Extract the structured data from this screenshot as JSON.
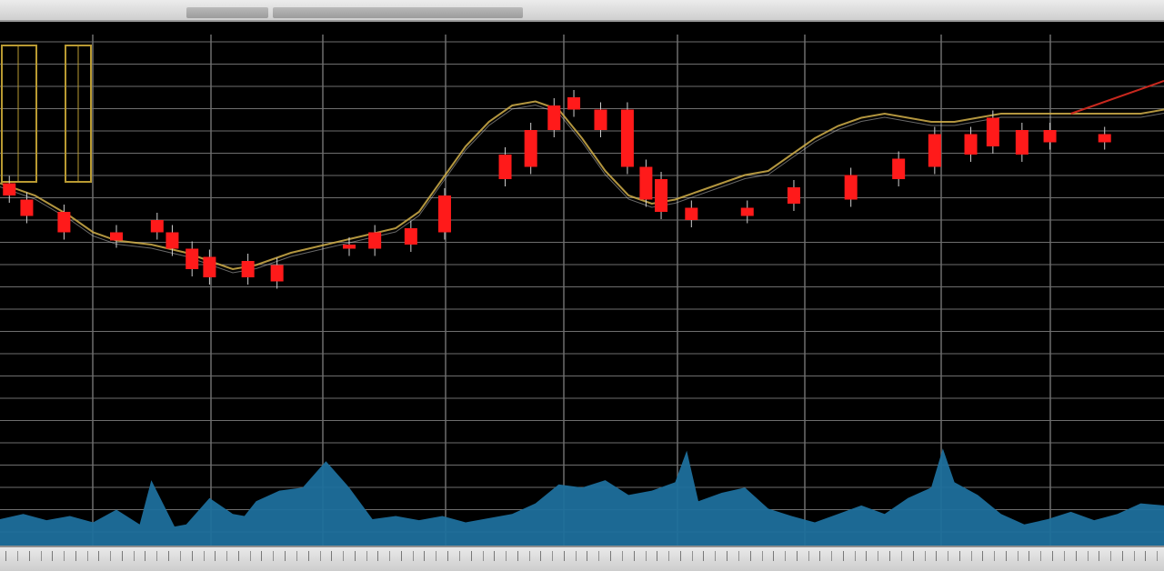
{
  "colors": {
    "background": "#000000",
    "grid": "#6e6e6e",
    "candle_down": "#ff1a1a",
    "wick": "#cfcfcf",
    "volume": "#1e6f9c",
    "price_line": "#d2b04a",
    "trend_line": "#c8281e"
  },
  "chart_data": {
    "type": "candlestick",
    "title": "",
    "xlabel": "",
    "ylabel": "",
    "grid": true,
    "xlim": [
      0,
      100
    ],
    "ylim": [
      0,
      100
    ],
    "volume_ylim": [
      0,
      100
    ],
    "price_line": {
      "x": [
        0,
        3,
        6,
        8,
        10,
        13,
        16,
        18,
        20,
        22,
        25,
        28,
        31,
        34,
        36,
        38,
        40,
        42,
        44,
        46,
        48,
        50,
        52,
        54,
        56,
        58,
        60,
        62,
        64,
        66,
        68,
        70,
        72,
        74,
        76,
        78,
        80,
        82,
        84,
        86,
        88,
        90,
        92,
        94,
        96,
        98,
        100
      ],
      "y": [
        65,
        62,
        57,
        53,
        51,
        50,
        48,
        46,
        44,
        45,
        48,
        50,
        52,
        54,
        58,
        66,
        74,
        80,
        84,
        85,
        83,
        76,
        68,
        62,
        60,
        61,
        63,
        65,
        67,
        68,
        72,
        76,
        79,
        81,
        82,
        81,
        80,
        80,
        81,
        82,
        82,
        82,
        82,
        82,
        82,
        82,
        83
      ]
    },
    "candles": [
      {
        "x": 0.8,
        "open": 65,
        "close": 62
      },
      {
        "x": 2.3,
        "open": 61,
        "close": 57
      },
      {
        "x": 5.5,
        "open": 58,
        "close": 53
      },
      {
        "x": 10.0,
        "open": 53,
        "close": 51
      },
      {
        "x": 13.5,
        "open": 56,
        "close": 53
      },
      {
        "x": 14.8,
        "open": 53,
        "close": 49
      },
      {
        "x": 16.5,
        "open": 49,
        "close": 44
      },
      {
        "x": 18.0,
        "open": 47,
        "close": 42
      },
      {
        "x": 21.3,
        "open": 46,
        "close": 42
      },
      {
        "x": 23.8,
        "open": 45,
        "close": 41
      },
      {
        "x": 30.0,
        "open": 50,
        "close": 49
      },
      {
        "x": 32.2,
        "open": 53,
        "close": 49
      },
      {
        "x": 35.3,
        "open": 54,
        "close": 50
      },
      {
        "x": 38.2,
        "open": 62,
        "close": 53
      },
      {
        "x": 43.4,
        "open": 72,
        "close": 66
      },
      {
        "x": 45.6,
        "open": 78,
        "close": 69
      },
      {
        "x": 47.6,
        "open": 84,
        "close": 78
      },
      {
        "x": 49.3,
        "open": 86,
        "close": 83
      },
      {
        "x": 51.6,
        "open": 83,
        "close": 78
      },
      {
        "x": 53.9,
        "open": 83,
        "close": 69
      },
      {
        "x": 55.5,
        "open": 69,
        "close": 61
      },
      {
        "x": 56.8,
        "open": 66,
        "close": 58
      },
      {
        "x": 59.4,
        "open": 59,
        "close": 56
      },
      {
        "x": 64.2,
        "open": 59,
        "close": 57
      },
      {
        "x": 68.2,
        "open": 64,
        "close": 60
      },
      {
        "x": 73.1,
        "open": 67,
        "close": 61
      },
      {
        "x": 77.2,
        "open": 71,
        "close": 66
      },
      {
        "x": 80.3,
        "open": 77,
        "close": 69
      },
      {
        "x": 83.4,
        "open": 77,
        "close": 72
      },
      {
        "x": 85.3,
        "open": 81,
        "close": 74
      },
      {
        "x": 87.8,
        "open": 78,
        "close": 72
      },
      {
        "x": 90.2,
        "open": 78,
        "close": 75
      },
      {
        "x": 94.9,
        "open": 77,
        "close": 75
      }
    ],
    "volume": {
      "x": [
        0,
        2,
        4,
        6,
        8,
        10,
        12,
        13,
        14,
        15,
        16,
        18,
        20,
        21,
        22,
        24,
        26,
        28,
        30,
        32,
        34,
        36,
        38,
        40,
        42,
        44,
        46,
        48,
        50,
        52,
        54,
        56,
        58,
        59,
        60,
        62,
        64,
        66,
        68,
        70,
        72,
        74,
        76,
        78,
        80,
        81,
        82,
        84,
        86,
        88,
        90,
        92,
        94,
        96,
        98,
        100
      ],
      "y": [
        25,
        30,
        24,
        28,
        22,
        34,
        20,
        62,
        40,
        18,
        20,
        45,
        30,
        28,
        42,
        52,
        55,
        80,
        55,
        25,
        28,
        24,
        28,
        22,
        26,
        30,
        40,
        58,
        55,
        62,
        48,
        52,
        60,
        90,
        42,
        50,
        55,
        35,
        28,
        22,
        30,
        38,
        30,
        45,
        55,
        92,
        60,
        48,
        30,
        20,
        25,
        32,
        24,
        30,
        40,
        38
      ]
    },
    "trend_line": {
      "x": [
        92,
        100
      ],
      "y": [
        82,
        90
      ]
    }
  },
  "footer": {
    "tick_label_count": 50
  }
}
